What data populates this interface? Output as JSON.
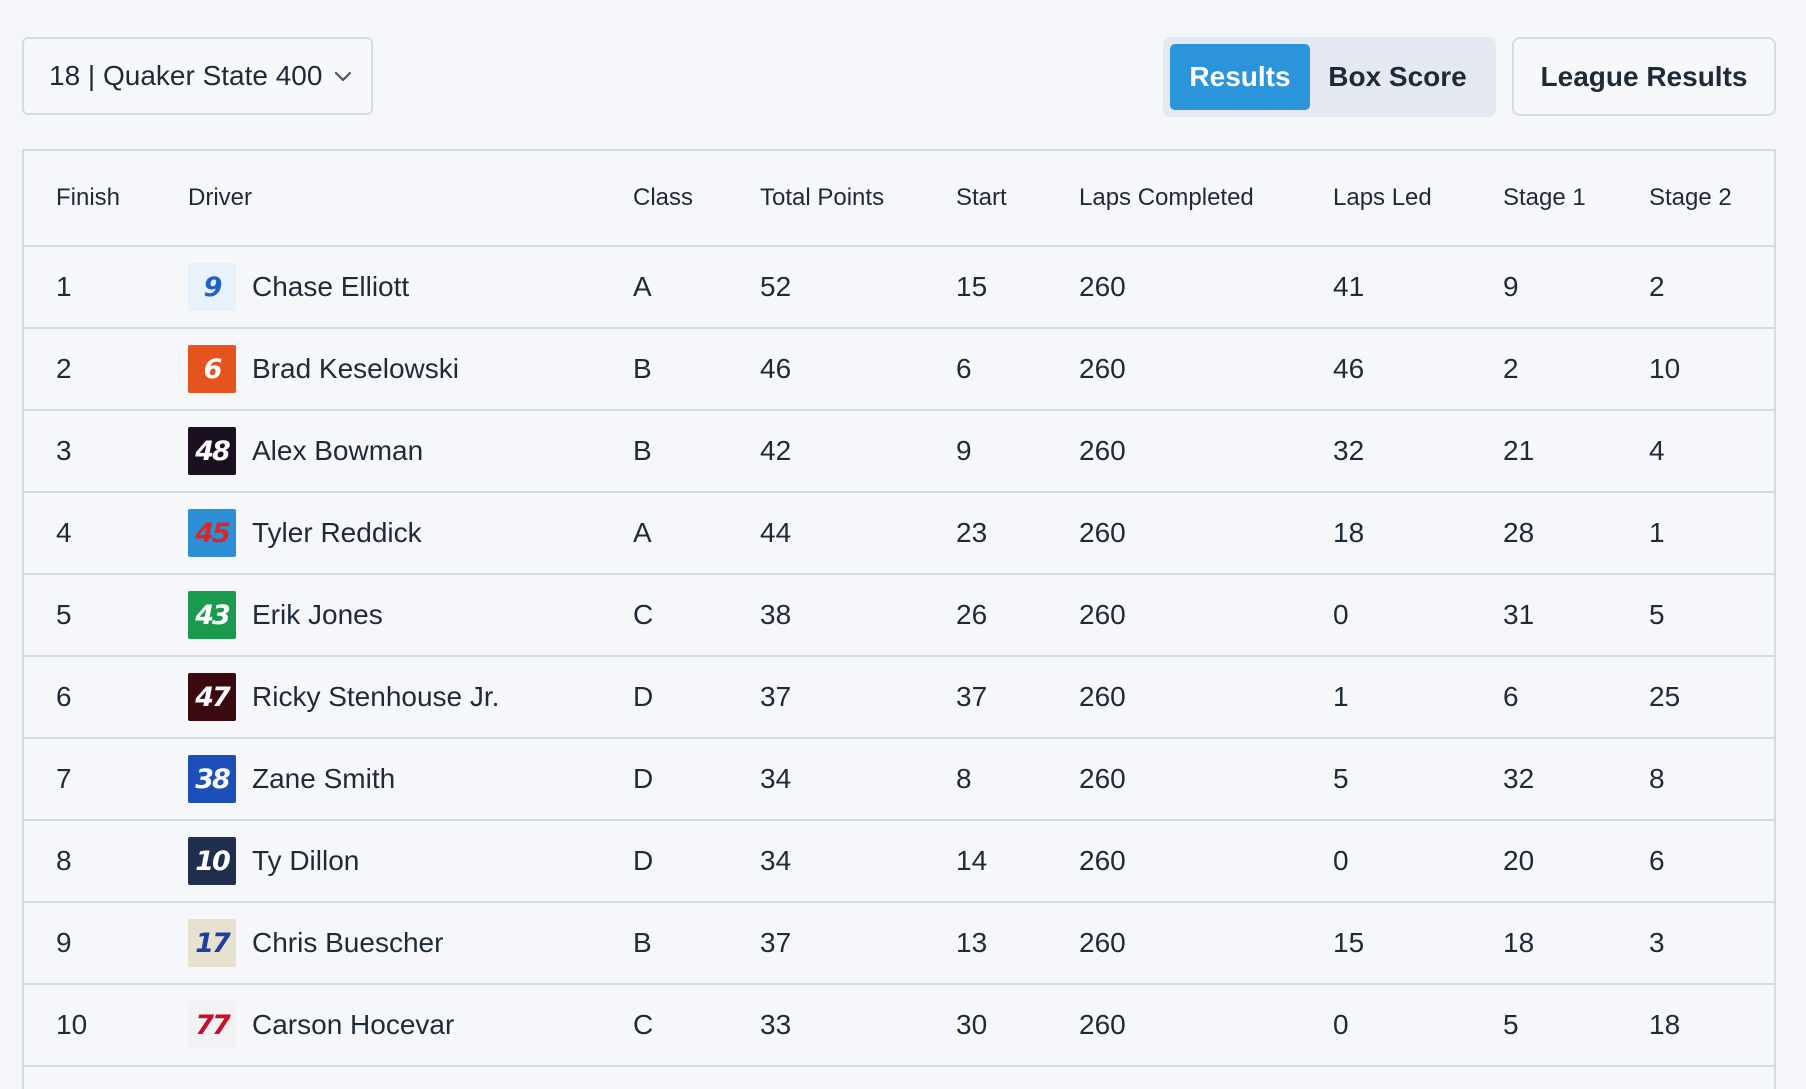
{
  "race_selector": {
    "value": "18 | Quaker State 400"
  },
  "view_toggle": {
    "results_label": "Results",
    "box_score_label": "Box Score"
  },
  "league_results_label": "League Results",
  "table": {
    "headers": [
      "Finish",
      "Driver",
      "Class",
      "Total Points",
      "Start",
      "Laps Completed",
      "Laps Led",
      "Stage 1",
      "Stage 2"
    ],
    "rows": [
      {
        "finish": "1",
        "driver": "Chase Elliott",
        "car": "9",
        "badge_bg": "#e9f1fb",
        "badge_fg": "#1d63c9",
        "class": "A",
        "total": "52",
        "start": "15",
        "laps": "260",
        "led": "41",
        "s1": "9",
        "s2": "2"
      },
      {
        "finish": "2",
        "driver": "Brad Keselowski",
        "car": "6",
        "badge_bg": "#e4541c",
        "badge_fg": "#ffffff",
        "class": "B",
        "total": "46",
        "start": "6",
        "laps": "260",
        "led": "46",
        "s1": "2",
        "s2": "10"
      },
      {
        "finish": "3",
        "driver": "Alex Bowman",
        "car": "48",
        "badge_bg": "#1b1020",
        "badge_fg": "#ffffff",
        "class": "B",
        "total": "42",
        "start": "9",
        "laps": "260",
        "led": "32",
        "s1": "21",
        "s2": "4"
      },
      {
        "finish": "4",
        "driver": "Tyler Reddick",
        "car": "45",
        "badge_bg": "#2d8fd6",
        "badge_fg": "#d6282b",
        "class": "A",
        "total": "44",
        "start": "23",
        "laps": "260",
        "led": "18",
        "s1": "28",
        "s2": "1"
      },
      {
        "finish": "5",
        "driver": "Erik Jones",
        "car": "43",
        "badge_bg": "#1a9a4d",
        "badge_fg": "#ffffff",
        "class": "C",
        "total": "38",
        "start": "26",
        "laps": "260",
        "led": "0",
        "s1": "31",
        "s2": "5"
      },
      {
        "finish": "6",
        "driver": "Ricky Stenhouse Jr.",
        "car": "47",
        "badge_bg": "#3a0a0e",
        "badge_fg": "#ffffff",
        "class": "D",
        "total": "37",
        "start": "37",
        "laps": "260",
        "led": "1",
        "s1": "6",
        "s2": "25"
      },
      {
        "finish": "7",
        "driver": "Zane Smith",
        "car": "38",
        "badge_bg": "#1d4fb8",
        "badge_fg": "#ffffff",
        "class": "D",
        "total": "34",
        "start": "8",
        "laps": "260",
        "led": "5",
        "s1": "32",
        "s2": "8"
      },
      {
        "finish": "8",
        "driver": "Ty Dillon",
        "car": "10",
        "badge_bg": "#1f2f4d",
        "badge_fg": "#ffffff",
        "class": "D",
        "total": "34",
        "start": "14",
        "laps": "260",
        "led": "0",
        "s1": "20",
        "s2": "6"
      },
      {
        "finish": "9",
        "driver": "Chris Buescher",
        "car": "17",
        "badge_bg": "#e9e1cf",
        "badge_fg": "#1d3fa3",
        "class": "B",
        "total": "37",
        "start": "13",
        "laps": "260",
        "led": "15",
        "s1": "18",
        "s2": "3"
      },
      {
        "finish": "10",
        "driver": "Carson Hocevar",
        "car": "77",
        "badge_bg": "#f2f2f5",
        "badge_fg": "#c8102e",
        "class": "C",
        "total": "33",
        "start": "30",
        "laps": "260",
        "led": "0",
        "s1": "5",
        "s2": "18"
      }
    ]
  }
}
